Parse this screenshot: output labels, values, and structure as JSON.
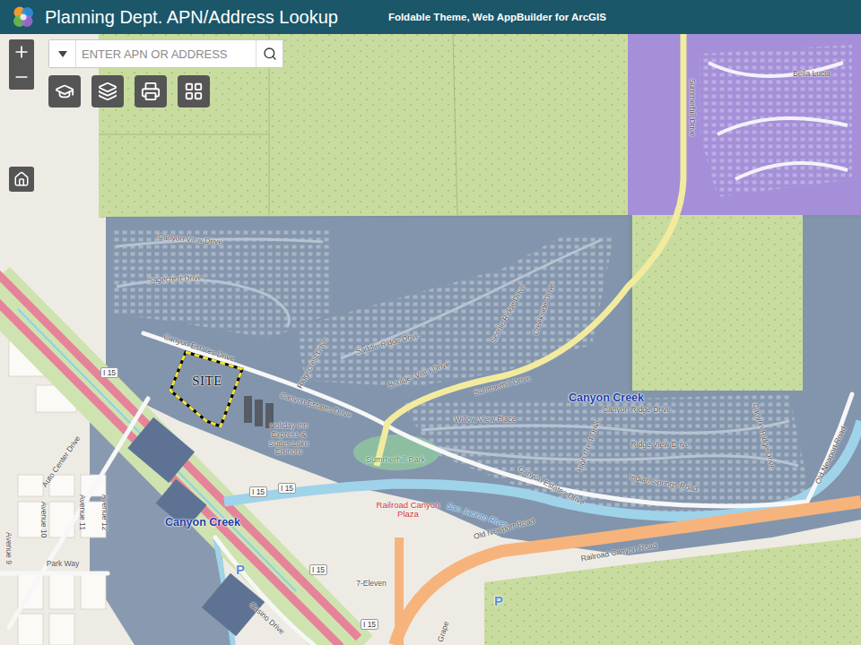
{
  "header": {
    "title": "Planning Dept. APN/Address Lookup",
    "subtitle": "Foldable Theme, Web AppBuilder for ArcGIS"
  },
  "search": {
    "placeholder": "ENTER APN OR ADDRESS"
  },
  "map": {
    "labels": [
      {
        "text": "SITE",
        "kind": "site"
      },
      {
        "text": "Canyon Creek",
        "kind": "area"
      },
      {
        "text": "Canyon Creek",
        "kind": "area"
      },
      {
        "text": "I 15",
        "kind": "highway"
      },
      {
        "text": "I 15",
        "kind": "highway"
      },
      {
        "text": "I 15",
        "kind": "highway"
      },
      {
        "text": "I 15",
        "kind": "highway"
      },
      {
        "text": "I 15",
        "kind": "highway"
      },
      {
        "text": "Holiday Inn Express & Suites Lake Elsinore",
        "kind": "poi"
      },
      {
        "text": "Canyon View Drive",
        "kind": "road"
      },
      {
        "text": "Sagecrest Drive",
        "kind": "road"
      },
      {
        "text": "Canyon Estates Drive",
        "kind": "road"
      },
      {
        "text": "Canyon Estates Drive",
        "kind": "road"
      },
      {
        "text": "Canyon Estates Drive",
        "kind": "road"
      },
      {
        "text": "Ridgecrest Drive",
        "kind": "road"
      },
      {
        "text": "Saddle Ridge Drive",
        "kind": "road"
      },
      {
        "text": "Boulder Vista Drive",
        "kind": "road"
      },
      {
        "text": "Scenic Ridge Drive",
        "kind": "road"
      },
      {
        "text": "Creekside Drive",
        "kind": "road"
      },
      {
        "text": "Summerhill Drive",
        "kind": "road"
      },
      {
        "text": "Summerhill Drive",
        "kind": "road"
      },
      {
        "text": "Willow View Place",
        "kind": "road"
      },
      {
        "text": "Canyon Ridge Drive",
        "kind": "road"
      },
      {
        "text": "Ridge View Drive",
        "kind": "road"
      },
      {
        "text": "High Crest Drive",
        "kind": "road"
      },
      {
        "text": "Indian Springs Road",
        "kind": "road"
      },
      {
        "text": "Canyon Ridge Drive",
        "kind": "road"
      },
      {
        "text": "Old Newport Road",
        "kind": "road"
      },
      {
        "text": "Old Newport Road",
        "kind": "road"
      },
      {
        "text": "Summerhill Park",
        "kind": "park"
      },
      {
        "text": "San Jacinto River",
        "kind": "water"
      },
      {
        "text": "Railroad Canyon Plaza",
        "kind": "store"
      },
      {
        "text": "Railroad Canyon Road",
        "kind": "road"
      },
      {
        "text": "7-Eleven",
        "kind": "poi"
      },
      {
        "text": "Auto Center Drive",
        "kind": "road"
      },
      {
        "text": "Casino Drive",
        "kind": "road"
      },
      {
        "text": "Park Way",
        "kind": "road"
      },
      {
        "text": "Avenue 9",
        "kind": "road"
      },
      {
        "text": "Avenue 10",
        "kind": "road"
      },
      {
        "text": "Avenue 11",
        "kind": "road"
      },
      {
        "text": "Avenue 12",
        "kind": "road"
      },
      {
        "text": "Grape",
        "kind": "road"
      },
      {
        "text": "P",
        "kind": "parking"
      },
      {
        "text": "P",
        "kind": "parking"
      },
      {
        "text": "Bella Lucia",
        "kind": "road"
      }
    ]
  }
}
